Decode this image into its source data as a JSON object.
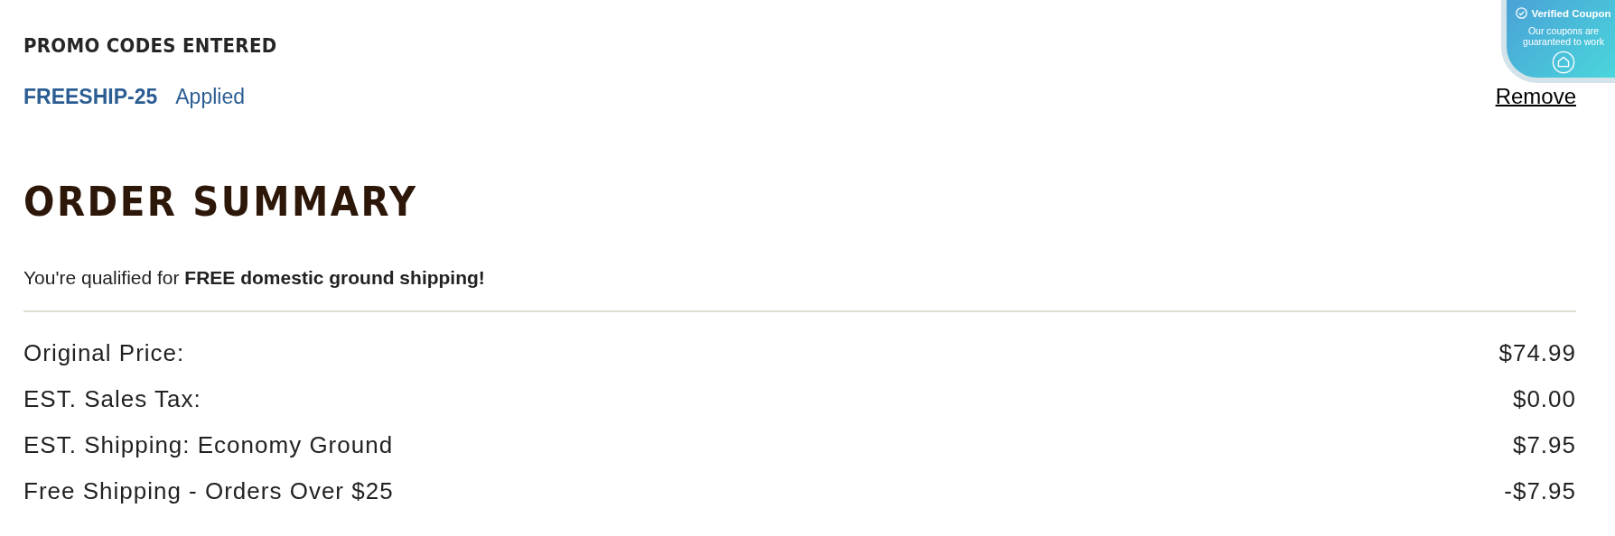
{
  "promo": {
    "title": "PROMO CODES ENTERED",
    "code": "FREESHIP-25",
    "status": "Applied",
    "remove": "Remove"
  },
  "badge": {
    "title": "Verified Coupon",
    "text": "Our coupons are guaranteed to work"
  },
  "summary": {
    "title": "ORDER SUMMARY",
    "notice": "You're qualified for **FREE domestic ground shipping!**",
    "rows": [
      {
        "label": "Original Price:",
        "value": "$74.99"
      },
      {
        "label": "EST. Sales Tax:",
        "value": "$0.00"
      },
      {
        "label": "EST. Shipping: Economy Ground",
        "value": "$7.95"
      },
      {
        "label": "Free Shipping - Orders Over $25",
        "value": "-$7.95"
      }
    ]
  }
}
